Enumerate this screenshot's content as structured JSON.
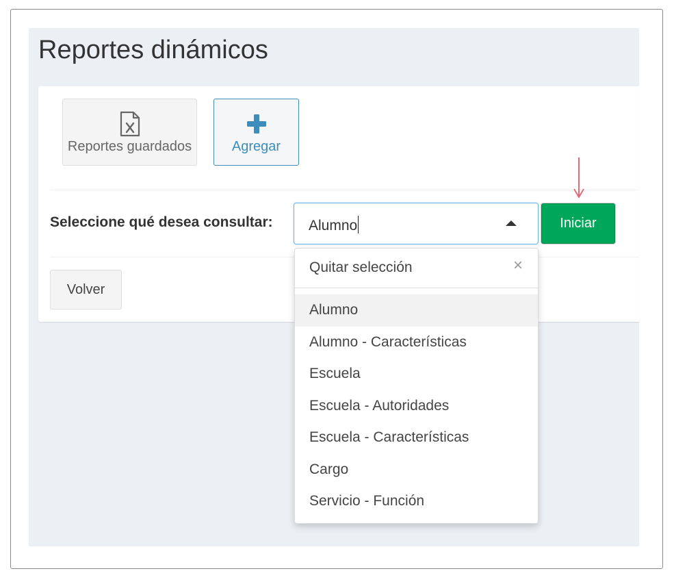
{
  "page": {
    "title": "Reportes dinámicos"
  },
  "toolbar": {
    "saved_reports_label": "Reportes guardados",
    "add_label": "Agregar"
  },
  "form": {
    "select_label": "Seleccione qué desea consultar:",
    "selected_value": "Alumno",
    "start_button_label": "Iniciar",
    "back_button_label": "Volver"
  },
  "dropdown": {
    "clear_label": "Quitar selección",
    "close_glyph": "×",
    "options": [
      "Alumno",
      "Alumno - Características",
      "Escuela",
      "Escuela - Autoridades",
      "Escuela - Características",
      "Cargo",
      "Servicio - Función"
    ],
    "selected_index": 0
  },
  "colors": {
    "accent_blue": "#3c8dbc",
    "success_green": "#00a65a",
    "indicator_arrow": "#e06c75",
    "background": "#ecf0f5"
  },
  "icons": {
    "saved_reports": "file-excel-icon",
    "add": "plus-icon",
    "dropdown_toggle": "caret-up-icon",
    "indicator": "arrow-down-icon"
  }
}
